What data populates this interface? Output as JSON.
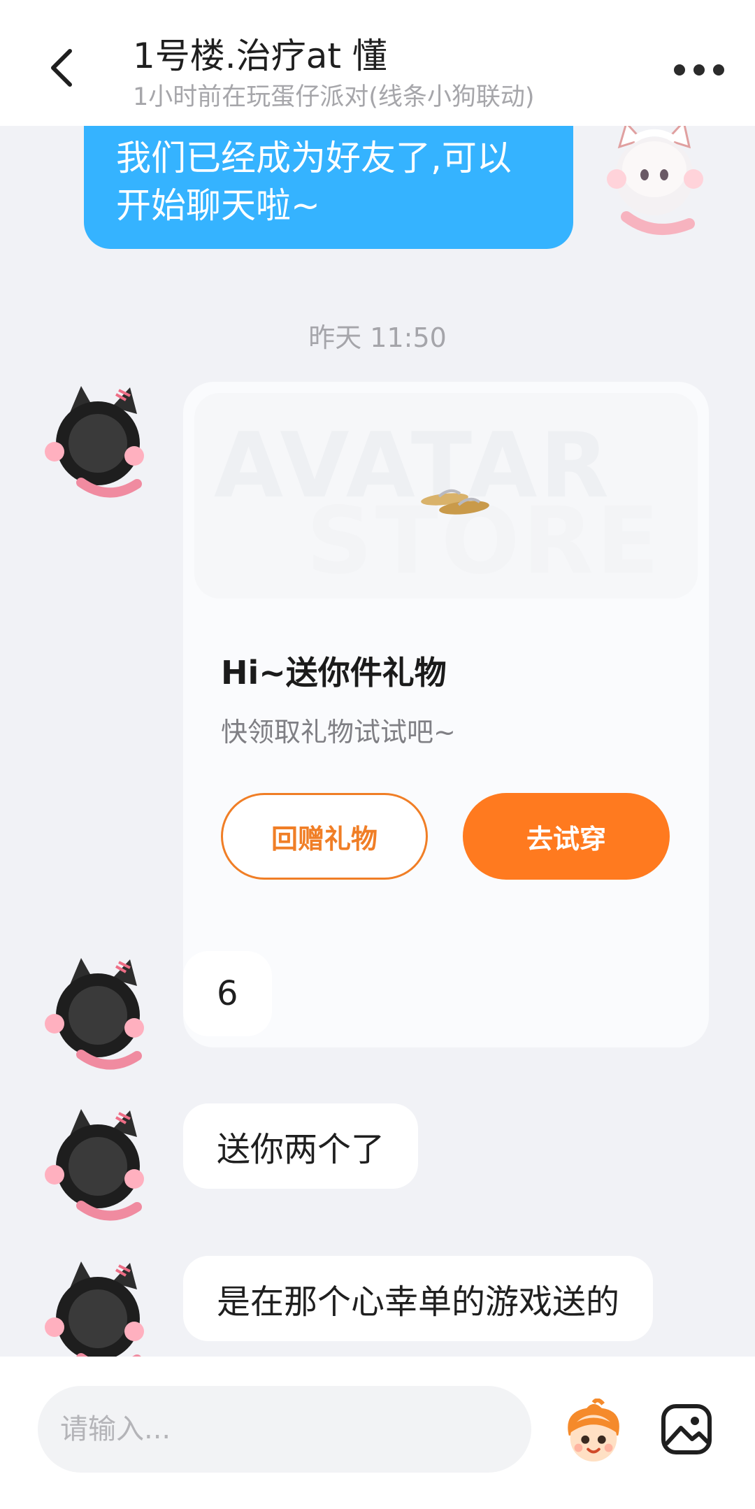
{
  "header": {
    "title": "1号楼.治疗at 懂",
    "subtitle": "1小时前在玩蛋仔派对(线条小狗联动)",
    "back_icon": "chevron-left-icon",
    "more_icon": "more-dots-icon"
  },
  "messages": {
    "self_greeting": "我们已经成为好友了,可以开始聊天啦~",
    "timestamp": "昨天 11:50",
    "gift_card": {
      "watermark_line1": "AVATAR",
      "watermark_line2": "STORE",
      "title": "Hi~送你件礼物",
      "description": "快领取礼物试试吧~",
      "return_gift_label": "回赠礼物",
      "try_on_label": "去试穿"
    },
    "other": [
      "6",
      "送你两个了",
      "是在那个心幸单的游戏送的"
    ]
  },
  "composer": {
    "placeholder": "请输入...",
    "emoji_icon": "emoji-icon",
    "image_icon": "image-icon"
  },
  "colors": {
    "accent_blue": "#35b3ff",
    "accent_orange": "#ff7a1f",
    "background": "#f1f2f6"
  }
}
